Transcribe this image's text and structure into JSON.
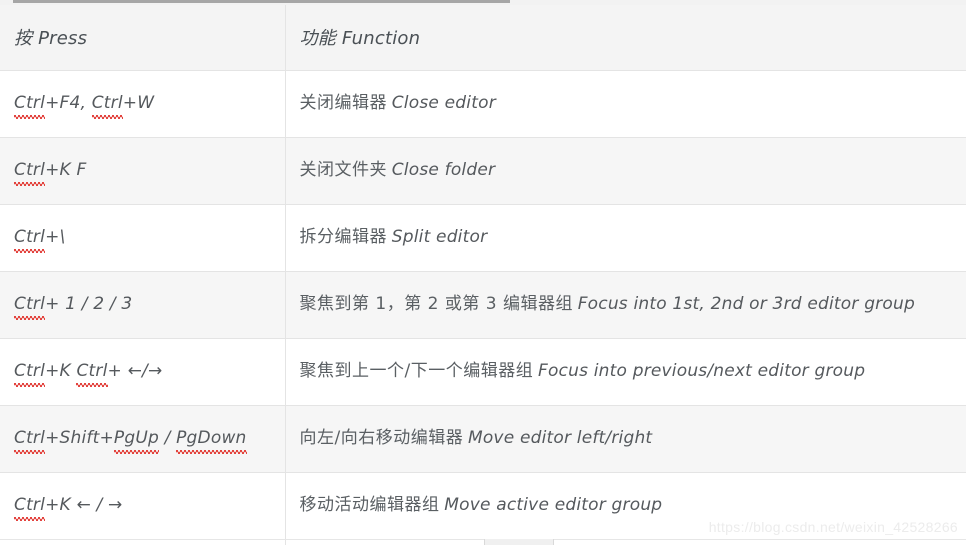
{
  "table": {
    "headers": {
      "press": "按 Press",
      "function": "功能 Function"
    },
    "rows": [
      {
        "press_plain": "Ctrl+F4, Ctrl+W",
        "press_parts": [
          {
            "text": "Ctrl",
            "squiggle": true
          },
          {
            "text": "+F4, ",
            "squiggle": false
          },
          {
            "text": "Ctrl",
            "squiggle": true
          },
          {
            "text": "+W",
            "squiggle": false
          }
        ],
        "function_cjk": "关闭编辑器",
        "function_latin": "Close editor"
      },
      {
        "press_plain": "Ctrl+K F",
        "press_parts": [
          {
            "text": "Ctrl",
            "squiggle": true
          },
          {
            "text": "+K F",
            "squiggle": false
          }
        ],
        "function_cjk": "关闭文件夹",
        "function_latin": "Close folder"
      },
      {
        "press_plain": "Ctrl+\\",
        "press_parts": [
          {
            "text": "Ctrl",
            "squiggle": true
          },
          {
            "text": "+\\",
            "squiggle": false
          }
        ],
        "function_cjk": "拆分编辑器",
        "function_latin": "Split editor"
      },
      {
        "press_plain": "Ctrl+ 1 / 2 / 3",
        "press_parts": [
          {
            "text": "Ctrl",
            "squiggle": true
          },
          {
            "text": "+ 1 / 2 / 3",
            "squiggle": false
          }
        ],
        "function_cjk": "聚焦到第 1，第 2 或第 3 编辑器组",
        "function_latin": "Focus into 1st, 2nd or 3rd editor group"
      },
      {
        "press_plain": "Ctrl+K Ctrl+ ←/→",
        "press_parts": [
          {
            "text": "Ctrl",
            "squiggle": true
          },
          {
            "text": "+K ",
            "squiggle": false
          },
          {
            "text": "Ctrl",
            "squiggle": true
          },
          {
            "text": "+ ←/→",
            "squiggle": false
          }
        ],
        "function_cjk": "聚焦到上一个/下一个编辑器组",
        "function_latin": "Focus into previous/next editor group"
      },
      {
        "press_plain": "Ctrl+Shift+PgUp / PgDown",
        "press_parts": [
          {
            "text": "Ctrl",
            "squiggle": true
          },
          {
            "text": "+Shift+",
            "squiggle": false
          },
          {
            "text": "PgUp",
            "squiggle": true
          },
          {
            "text": " / ",
            "squiggle": false
          },
          {
            "text": "PgDown",
            "squiggle": true
          }
        ],
        "function_cjk": "向左/向右移动编辑器",
        "function_latin": "Move editor left/right"
      },
      {
        "press_plain": "Ctrl+K ← / →",
        "press_parts": [
          {
            "text": "Ctrl",
            "squiggle": true
          },
          {
            "text": "+K ← / →",
            "squiggle": false
          }
        ],
        "function_cjk": "移动活动编辑器组",
        "function_latin": "Move active editor group"
      }
    ]
  },
  "watermark": "https://blog.csdn.net/weixin_42528266"
}
